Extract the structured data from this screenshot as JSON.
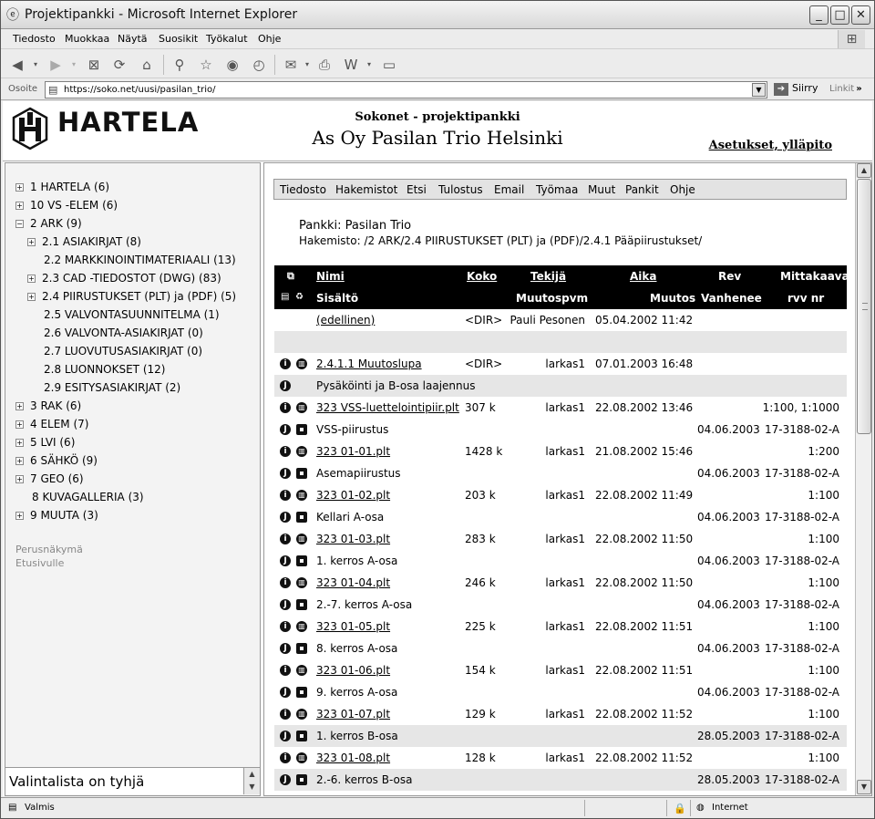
{
  "window": {
    "title": "Projektipankki - Microsoft Internet Explorer",
    "min": "_",
    "max": "□",
    "close": "✕"
  },
  "menubar": [
    "Tiedosto",
    "Muokkaa",
    "Näytä",
    "Suosikit",
    "Työkalut",
    "Ohje"
  ],
  "address": {
    "label": "Osoite",
    "url": "https://soko.net/uusi/pasilan_trio/",
    "go_label": "Siirry",
    "links_label": "Linkit"
  },
  "header": {
    "brand": "HARTELA",
    "subtitle": "Sokonet - projektipankki",
    "title": "As Oy Pasilan Trio Helsinki",
    "settings_link": "Asetukset, ylläpito"
  },
  "tree": [
    {
      "label": "1 HARTELA (6)",
      "expander": "+",
      "indent": 0
    },
    {
      "label": "10 VS -ELEM (6)",
      "expander": "+",
      "indent": 0
    },
    {
      "label": "2 ARK (9)",
      "expander": "−",
      "indent": 0
    },
    {
      "label": "2.1 ASIAKIRJAT (8)",
      "expander": "+",
      "indent": 1
    },
    {
      "label": "2.2 MARKKINOINTIMATERIAALI (13)",
      "expander": "",
      "indent": 1
    },
    {
      "label": "2.3 CAD -TIEDOSTOT (DWG) (83)",
      "expander": "+",
      "indent": 1
    },
    {
      "label": "2.4 PIIRUSTUKSET (PLT) ja (PDF) (5)",
      "expander": "+",
      "indent": 1
    },
    {
      "label": "2.5 VALVONTASUUNNITELMA (1)",
      "expander": "",
      "indent": 1
    },
    {
      "label": "2.6 VALVONTA-ASIAKIRJAT (0)",
      "expander": "",
      "indent": 1
    },
    {
      "label": "2.7 LUOVUTUSASIAKIRJAT (0)",
      "expander": "",
      "indent": 1
    },
    {
      "label": "2.8 LUONNOKSET (12)",
      "expander": "",
      "indent": 1
    },
    {
      "label": "2.9 ESITYSASIAKIRJAT (2)",
      "expander": "",
      "indent": 1
    },
    {
      "label": "3 RAK (6)",
      "expander": "+",
      "indent": 0
    },
    {
      "label": "4 ELEM (7)",
      "expander": "+",
      "indent": 0
    },
    {
      "label": "5 LVI (6)",
      "expander": "+",
      "indent": 0
    },
    {
      "label": "6 SÄHKÖ (9)",
      "expander": "+",
      "indent": 0
    },
    {
      "label": "7 GEO (6)",
      "expander": "+",
      "indent": 0
    },
    {
      "label": "8 KUVAGALLERIA (3)",
      "expander": "",
      "indent": 0
    },
    {
      "label": "9 MUUTA (3)",
      "expander": "+",
      "indent": 0
    }
  ],
  "sidelinks": [
    "Perusnäkymä",
    "Etusivulle"
  ],
  "selection_list": "Valintalista on tyhjä",
  "content_menu": [
    "Tiedosto",
    "Hakemistot",
    "Etsi",
    "Tulostus",
    "Email",
    "Työmaa",
    "Muut",
    "Pankit",
    "Ohje"
  ],
  "location": {
    "pankki": "Pankki: Pasilan Trio",
    "hakemisto": "Hakemisto: /2 ARK/2.4 PIIRUSTUKSET (PLT) ja (PDF)/2.4.1 Pääpiirustukset/"
  },
  "table_header": {
    "row1": {
      "nimi": "Nimi",
      "koko": "Koko",
      "tekija": "Tekijä",
      "aika": "Aika",
      "rev": "Rev",
      "mittakaava": "Mittakaava"
    },
    "row2": {
      "sisalto": "Sisältö",
      "muutospvm": "Muutospvm",
      "muutos": "Muutos",
      "vanhenee": "Vanhenee",
      "rvv": "rvv nr"
    }
  },
  "rows": [
    {
      "kind": "file",
      "icon1": "",
      "icon2": "",
      "name": "(edellinen)",
      "link": true,
      "size": "<DIR>",
      "author": "Pauli Pesonen",
      "time": "05.04.2002 11:42",
      "scale": "",
      "shade": false
    },
    {
      "kind": "blank",
      "shade": true
    },
    {
      "kind": "file",
      "icon1": "i",
      "icon2": "w",
      "name": "2.4.1.1 Muutoslupa",
      "link": true,
      "size": "<DIR>",
      "author": "larkas1",
      "time": "07.01.2003 16:48",
      "scale": "",
      "shade": false
    },
    {
      "kind": "desc",
      "icon1": "J",
      "icon2": "",
      "desc": "Pysäköinti ja B-osa laajennus",
      "date": "",
      "rvv": "",
      "shade": true
    },
    {
      "kind": "file",
      "icon1": "i",
      "icon2": "w",
      "name": "323 VSS-luettelointipiir.plt",
      "link": true,
      "size": "307 k",
      "author": "larkas1",
      "time": "22.08.2002 13:46",
      "scale": "1:100, 1:1000",
      "shade": false
    },
    {
      "kind": "desc",
      "icon1": "J",
      "icon2": "d",
      "desc": "VSS-piirustus",
      "date": "04.06.2003",
      "rvv": "17-3188-02-A",
      "shade": false
    },
    {
      "kind": "file",
      "icon1": "i",
      "icon2": "w",
      "name": "323 01-01.plt",
      "link": true,
      "size": "1428 k",
      "author": "larkas1",
      "time": "21.08.2002 15:46",
      "scale": "1:200",
      "shade": false
    },
    {
      "kind": "desc",
      "icon1": "J",
      "icon2": "d",
      "desc": "Asemapiirustus",
      "date": "04.06.2003",
      "rvv": "17-3188-02-A",
      "shade": false
    },
    {
      "kind": "file",
      "icon1": "i",
      "icon2": "w",
      "name": "323 01-02.plt",
      "link": true,
      "size": "203 k",
      "author": "larkas1",
      "time": "22.08.2002 11:49",
      "scale": "1:100",
      "shade": false
    },
    {
      "kind": "desc",
      "icon1": "J",
      "icon2": "d",
      "desc": "Kellari A-osa",
      "date": "04.06.2003",
      "rvv": "17-3188-02-A",
      "shade": false
    },
    {
      "kind": "file",
      "icon1": "i",
      "icon2": "w",
      "name": "323 01-03.plt",
      "link": true,
      "size": "283 k",
      "author": "larkas1",
      "time": "22.08.2002 11:50",
      "scale": "1:100",
      "shade": false
    },
    {
      "kind": "desc",
      "icon1": "J",
      "icon2": "d",
      "desc": "1. kerros A-osa",
      "date": "04.06.2003",
      "rvv": "17-3188-02-A",
      "shade": false
    },
    {
      "kind": "file",
      "icon1": "i",
      "icon2": "w",
      "name": "323 01-04.plt",
      "link": true,
      "size": "246 k",
      "author": "larkas1",
      "time": "22.08.2002 11:50",
      "scale": "1:100",
      "shade": false
    },
    {
      "kind": "desc",
      "icon1": "J",
      "icon2": "d",
      "desc": "2.-7. kerros A-osa",
      "date": "04.06.2003",
      "rvv": "17-3188-02-A",
      "shade": false
    },
    {
      "kind": "file",
      "icon1": "i",
      "icon2": "w",
      "name": "323 01-05.plt",
      "link": true,
      "size": "225 k",
      "author": "larkas1",
      "time": "22.08.2002 11:51",
      "scale": "1:100",
      "shade": false
    },
    {
      "kind": "desc",
      "icon1": "J",
      "icon2": "d",
      "desc": "8. kerros A-osa",
      "date": "04.06.2003",
      "rvv": "17-3188-02-A",
      "shade": false
    },
    {
      "kind": "file",
      "icon1": "i",
      "icon2": "w",
      "name": "323 01-06.plt",
      "link": true,
      "size": "154 k",
      "author": "larkas1",
      "time": "22.08.2002 11:51",
      "scale": "1:100",
      "shade": false
    },
    {
      "kind": "desc",
      "icon1": "J",
      "icon2": "d",
      "desc": "9. kerros A-osa",
      "date": "04.06.2003",
      "rvv": "17-3188-02-A",
      "shade": false
    },
    {
      "kind": "file",
      "icon1": "i",
      "icon2": "w",
      "name": "323 01-07.plt",
      "link": true,
      "size": "129 k",
      "author": "larkas1",
      "time": "22.08.2002 11:52",
      "scale": "1:100",
      "shade": false
    },
    {
      "kind": "desc",
      "icon1": "J",
      "icon2": "d",
      "desc": "1. kerros B-osa",
      "date": "28.05.2003",
      "rvv": "17-3188-02-A",
      "shade": true
    },
    {
      "kind": "file",
      "icon1": "i",
      "icon2": "w",
      "name": "323 01-08.plt",
      "link": true,
      "size": "128 k",
      "author": "larkas1",
      "time": "22.08.2002 11:52",
      "scale": "1:100",
      "shade": false
    },
    {
      "kind": "desc",
      "icon1": "J",
      "icon2": "d",
      "desc": "2.-6. kerros B-osa",
      "date": "28.05.2003",
      "rvv": "17-3188-02-A",
      "shade": true
    }
  ],
  "status": {
    "text": "Valmis",
    "zone": "Internet"
  }
}
